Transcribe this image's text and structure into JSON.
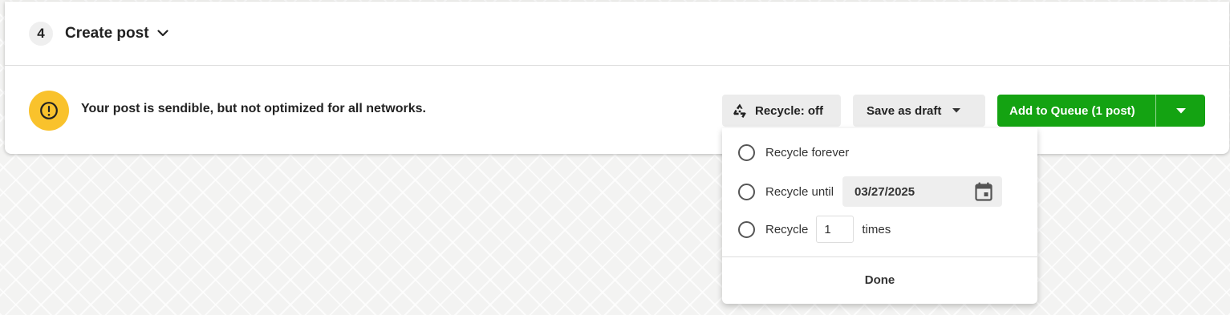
{
  "header": {
    "step_number": "4",
    "title": "Create post",
    "chevron_icon": "chevron-down-icon"
  },
  "status": {
    "icon": "exclamation-circle-icon",
    "icon_color": "#f9c22c",
    "message": "Your post is sendible, but not optimized for all networks."
  },
  "actions": {
    "recycle_icon": "recycle-icon",
    "recycle_label": "Recycle: off",
    "draft_label": "Save as draft",
    "queue_label": "Add to Queue (1 post)",
    "queue_color": "#14a312"
  },
  "recycle_menu": {
    "option_forever": "Recycle forever",
    "option_until": "Recycle until",
    "until_date": "03/27/2025",
    "calendar_icon": "calendar-icon",
    "option_times_prefix": "Recycle",
    "times_value": "1",
    "option_times_suffix": "times",
    "done_label": "Done"
  }
}
